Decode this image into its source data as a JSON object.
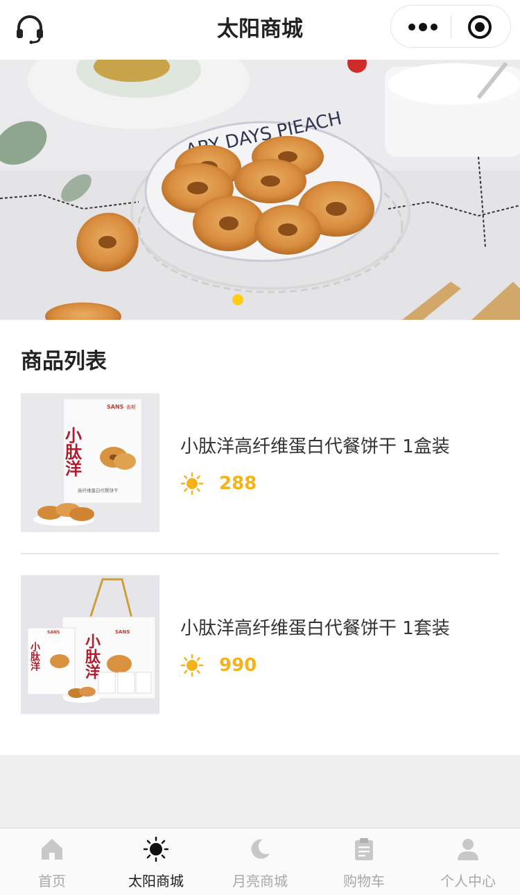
{
  "navbar": {
    "title": "太阳商城",
    "left_icon": "headset-icon",
    "capsule_more_icon": "more-dots-icon",
    "capsule_close_icon": "target-icon"
  },
  "banner": {
    "slide_count": 1,
    "active_index": 0,
    "plate_text": "ARY DAYS PIEACH"
  },
  "section": {
    "title": "商品列表"
  },
  "products": [
    {
      "name": "小肽洋高纤维蛋白代餐饼干 1盒装",
      "price": "288",
      "price_icon": "sun-icon"
    },
    {
      "name": "小肽洋高纤维蛋白代餐饼干 1套装",
      "price": "990",
      "price_icon": "sun-icon"
    }
  ],
  "product_packaging": {
    "brand": "SANS",
    "brand_cn": "善斯",
    "product_title": "小肽洋",
    "subtitle": "高纤维蛋白代餐饼干"
  },
  "tabs": [
    {
      "label": "首页",
      "icon": "home-icon",
      "active": false
    },
    {
      "label": "太阳商城",
      "icon": "sun-icon",
      "active": true
    },
    {
      "label": "月亮商城",
      "icon": "moon-icon",
      "active": false
    },
    {
      "label": "购物车",
      "icon": "clipboard-icon",
      "active": false
    },
    {
      "label": "个人中心",
      "icon": "person-icon",
      "active": false
    }
  ],
  "colors": {
    "accent": "#f5b21b",
    "dot_active": "#ffcc11",
    "tab_active": "#1a1a1a",
    "tab_inactive": "#a8a8a8"
  }
}
